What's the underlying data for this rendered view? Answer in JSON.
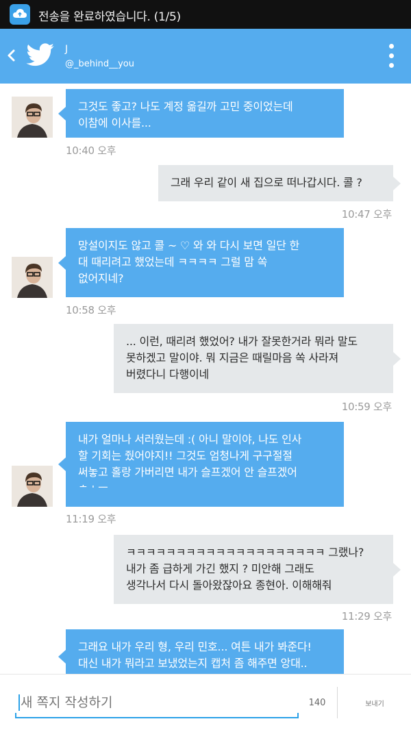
{
  "status_bar": {
    "notification_text": "전송을 완료하였습니다. (1/5)",
    "app_icon": "cloud-upload-icon"
  },
  "header": {
    "back_icon": "chevron-left-icon",
    "logo_icon": "twitter-bird-icon",
    "title": "J",
    "subtitle": "@_behind__you",
    "menu_icon": "overflow-menu-icon",
    "background_color": "#55acee"
  },
  "messages": [
    {
      "direction": "in",
      "lines": [
        "그것도 좋고? 나도 계정 옮길까 고민 중이었는데",
        "이참에 이사를..."
      ],
      "time": "10:40 오후"
    },
    {
      "direction": "out",
      "lines": [
        "그래 우리 같이 새 집으로 떠나갑시다. 콜 ?"
      ],
      "time": "10:47 오후"
    },
    {
      "direction": "in",
      "lines": [
        "망설이지도 않고 콜 ~ ♡ 와 와 다시 보면 일단 한",
        "대 때리려고 했었는데 ㅋㅋㅋㅋ 그럴 맘 쏙",
        "없어지네?"
      ],
      "time": "10:58 오후"
    },
    {
      "direction": "out",
      "lines": [
        "... 이런, 때리려 했었어? 내가 잘못한거라 뭐라 말도",
        "못하겠고 말이야. 뭐 지금은 때릴마음 쏙 사라져",
        "버렸다니 다행이네"
      ],
      "time": "10:59 오후"
    },
    {
      "direction": "in",
      "lines": [
        "내가 얼마나 서러웠는데 :( 아니 말이야, 나도 인사",
        "할 기회는 줬어야지!! 그것도 엄청나게 구구절절",
        "써놓고 홀랑 가버리면 내가 슬프겠어 안 슬프겠어",
        "ㅎㅅㅜ"
      ],
      "time": "11:19 오후"
    },
    {
      "direction": "out",
      "lines": [
        "ㅋㅋㅋㅋㅋㅋㅋㅋㅋㅋㅋㅋㅋㅋㅋㅋㅋㅋㅋㅋ 그랬나?",
        "내가 좀 급하게 가긴 했지 ? 미안해 그래도",
        "생각나서 다시 돌아왔잖아요 종현아. 이해해줘"
      ],
      "time": "11:29 오후"
    },
    {
      "direction": "in",
      "lines": [
        "그래요 내가 우리 형, 우리 민호... 여튼 내가 봐준다!",
        "대신 내가 뭐라고 보냈었는지 캡처 좀 해주면 앙대.."
      ],
      "time": ""
    }
  ],
  "compose": {
    "placeholder": "새 쪽지 작성하기",
    "char_count": "140",
    "send_label": "보내기"
  },
  "colors": {
    "incoming_bubble": "#55acee",
    "outgoing_bubble": "#e5e8ea",
    "accent": "#2aa1e8"
  }
}
